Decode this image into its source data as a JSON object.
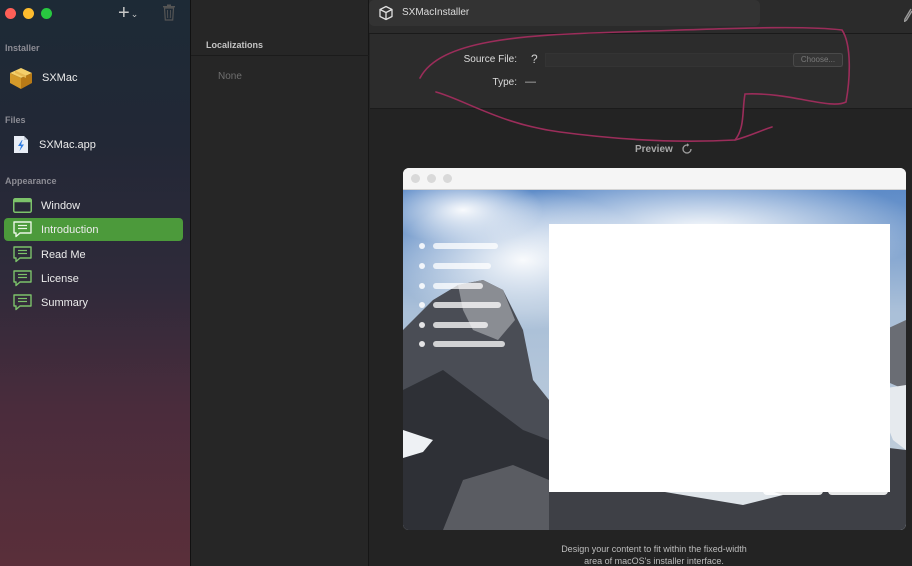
{
  "window": {
    "title": "SXMacInstaller"
  },
  "toolbar": {
    "add_icon": "plus-icon",
    "trash_icon": "trash-icon"
  },
  "sidebar": {
    "sections": {
      "installer": "Installer",
      "files": "Files",
      "appearance": "Appearance"
    },
    "installer_item": {
      "label": "SXMac",
      "icon": "package-icon"
    },
    "file_item": {
      "label": "SXMac.app",
      "icon": "app-file-icon"
    },
    "appearance_items": [
      {
        "label": "Window",
        "icon": "window-icon",
        "selected": false
      },
      {
        "label": "Introduction",
        "icon": "speech-bubble-icon",
        "selected": true
      },
      {
        "label": "Read Me",
        "icon": "speech-bubble-icon",
        "selected": false
      },
      {
        "label": "License",
        "icon": "speech-bubble-icon",
        "selected": false
      },
      {
        "label": "Summary",
        "icon": "speech-bubble-icon",
        "selected": false
      }
    ],
    "selected_color": "#4c9a3b"
  },
  "localizations": {
    "header": "Localizations",
    "empty": "None"
  },
  "detail": {
    "source_file_label": "Source File:",
    "source_file_value": "?",
    "choose_button": "Choose...",
    "type_label": "Type:",
    "type_value": "—"
  },
  "preview": {
    "label": "Preview",
    "hint_line1": "Design your content to fit within the fixed-width",
    "hint_line2": "area of macOS's installer interface."
  }
}
